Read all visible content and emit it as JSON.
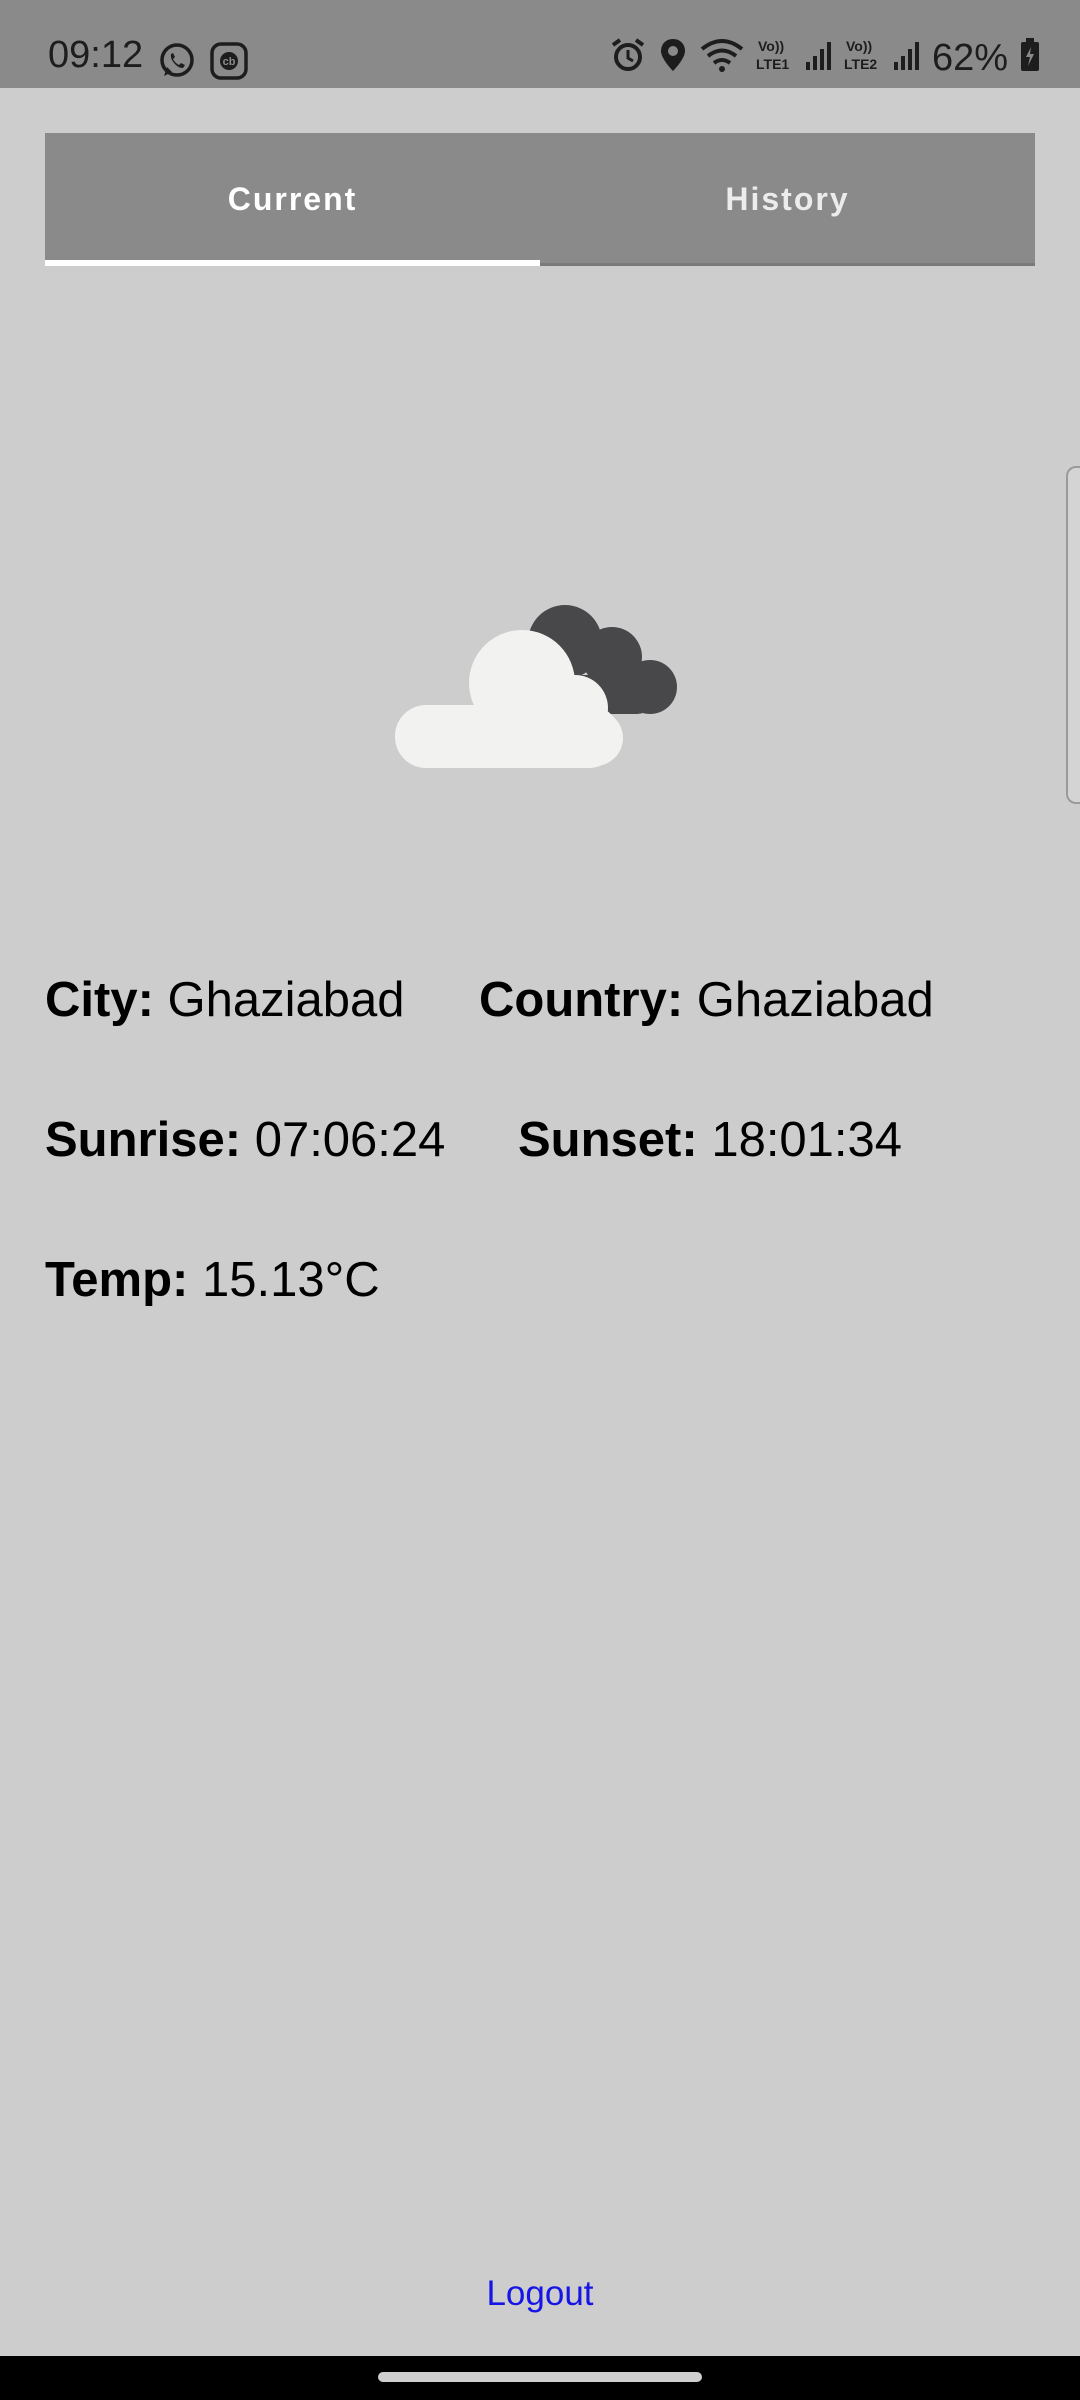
{
  "status_bar": {
    "time": "09:12",
    "left_icons": [
      "whatsapp-icon",
      "cb-app-icon"
    ],
    "right_icons": [
      "alarm-icon",
      "location-icon",
      "wifi-icon",
      "volte-lte1-signal-icon",
      "volte-lte2-signal-icon",
      "battery-charging-icon"
    ],
    "sim1_label": "Vo)) LTE1",
    "sim2_label": "Vo)) LTE2",
    "battery": "62%"
  },
  "tabs": [
    {
      "label": "Current",
      "active": true
    },
    {
      "label": "History",
      "active": false
    }
  ],
  "weather": {
    "icon": "partly-cloudy-icon",
    "city_label": "City:",
    "city": "Ghaziabad",
    "country_label": "Country:",
    "country": "Ghaziabad",
    "sunrise_label": "Sunrise:",
    "sunrise": "07:06:24",
    "sunset_label": "Sunset:",
    "sunset": "18:01:34",
    "temp_label": "Temp:",
    "temp": "15.13°C"
  },
  "logout_label": "Logout",
  "colors": {
    "background": "#cdcdcd",
    "tab_bar": "#8a8a8a",
    "link": "#1515e6"
  }
}
